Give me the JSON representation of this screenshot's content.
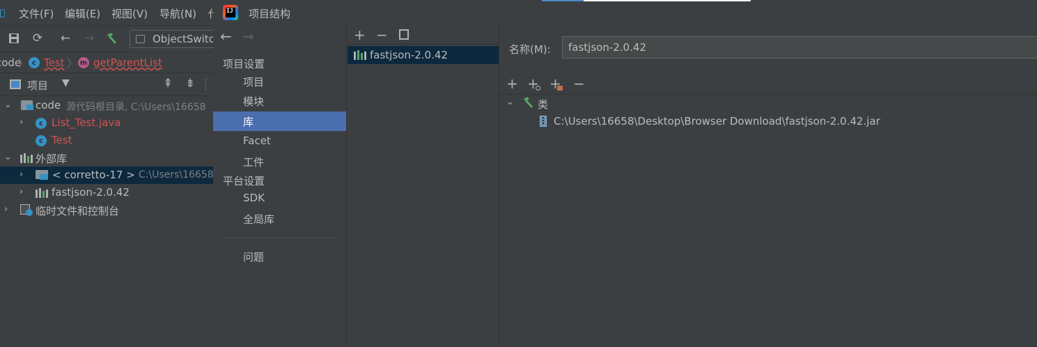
{
  "ide": {
    "menu": [
      "文件(F)",
      "编辑(E)",
      "视图(V)",
      "导航(N)",
      "代"
    ],
    "run_config": "ObjectSwitch",
    "breadcrumbs": [
      "code",
      "Test",
      "getParentList"
    ],
    "project_view_label": "项目",
    "tree": [
      {
        "label": "code",
        "hint": "源代码根目录, C:\\Users\\16658"
      },
      {
        "label": "List_Test.java"
      },
      {
        "label": "Test"
      },
      {
        "label": "外部库"
      },
      {
        "label": "< corretto-17 >",
        "hint": "C:\\Users\\16658"
      },
      {
        "label": "fastjson-2.0.42"
      },
      {
        "label": "临时文件和控制台"
      }
    ]
  },
  "dialog": {
    "title": "项目结构",
    "nav": {
      "project_settings_header": "项目设置",
      "project_settings_items": [
        "项目",
        "模块",
        "库",
        "Facet",
        "工件"
      ],
      "platform_settings_header": "平台设置",
      "platform_settings_items": [
        "SDK",
        "全局库"
      ],
      "problems": "问题",
      "selected": "库"
    },
    "libraries": [
      "fastjson-2.0.42"
    ],
    "detail": {
      "name_label": "名称(M):",
      "name_value": "fastjson-2.0.42",
      "classes_label": "类",
      "class_path": "C:\\Users\\16658\\Desktop\\Browser Download\\fastjson-2.0.42.jar"
    }
  },
  "colors": {
    "background": "#3c3f41",
    "selection": "#4b6eaf",
    "tree_selection": "#0d293e",
    "error_text": "#d25252"
  }
}
